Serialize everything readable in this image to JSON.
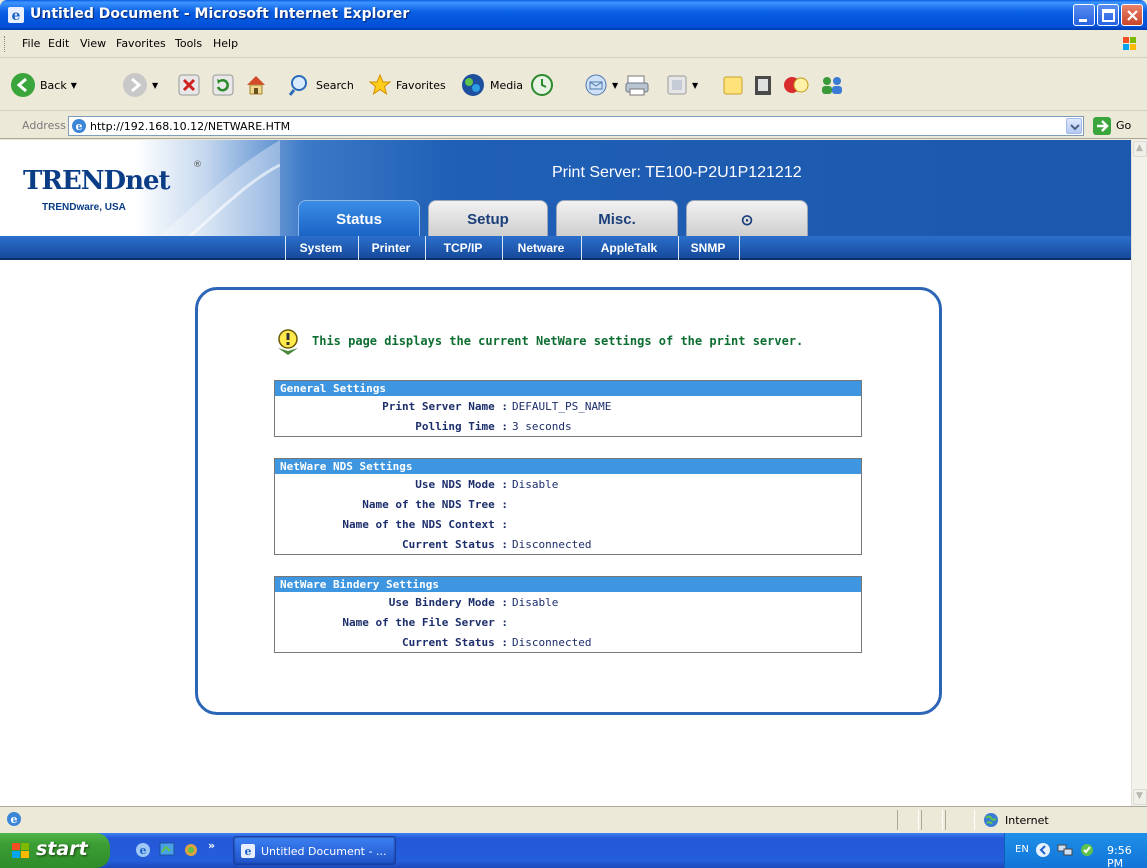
{
  "window": {
    "title": "Untitled Document - Microsoft Internet Explorer"
  },
  "menu": [
    "File",
    "Edit",
    "View",
    "Favorites",
    "Tools",
    "Help"
  ],
  "toolbar": {
    "back_label": "Back",
    "search_label": "Search",
    "favorites_label": "Favorites",
    "media_label": "Media"
  },
  "address": {
    "label": "Address",
    "url": "http://192.168.10.12/NETWARE.HTM",
    "go_label": "Go"
  },
  "page": {
    "logo": "TRENDnet",
    "logo_reg": "®",
    "logo_sub": "TRENDware, USA",
    "server_title": "Print Server: TE100-P2U1P121212",
    "tabs": {
      "status": "Status",
      "setup": "Setup",
      "misc": "Misc.",
      "power_glyph": "⊙"
    },
    "subnav": [
      "System",
      "Printer",
      "TCP/IP",
      "Netware",
      "AppleTalk",
      "SNMP"
    ],
    "intro": "This page displays the current NetWare settings of the print server.",
    "general": {
      "header": "General Settings",
      "rows": [
        {
          "k": "Print Server Name :",
          "v": "DEFAULT_PS_NAME"
        },
        {
          "k": "Polling Time :",
          "v": "3 seconds"
        }
      ]
    },
    "nds": {
      "header": "NetWare NDS Settings",
      "rows": [
        {
          "k": "Use NDS Mode :",
          "v": "Disable"
        },
        {
          "k": "Name of the NDS Tree :",
          "v": ""
        },
        {
          "k": "Name of the NDS Context :",
          "v": ""
        },
        {
          "k": "Current Status :",
          "v": "Disconnected"
        }
      ]
    },
    "bindery": {
      "header": "NetWare Bindery Settings",
      "rows": [
        {
          "k": "Use Bindery Mode :",
          "v": "Disable"
        },
        {
          "k": "Name of the File Server :",
          "v": ""
        },
        {
          "k": "Current Status :",
          "v": "Disconnected"
        }
      ]
    }
  },
  "status_bar": {
    "zone": "Internet"
  },
  "taskbar": {
    "start_label": "start",
    "more": "»",
    "task_label": "Untitled Document - ...",
    "lang": "EN",
    "clock": "9:56 PM"
  },
  "colors": {
    "accent": "#1c58ad",
    "section_header": "#3e95e0",
    "intro_text": "#0d6e31",
    "value_text": "#1c2e6b"
  }
}
